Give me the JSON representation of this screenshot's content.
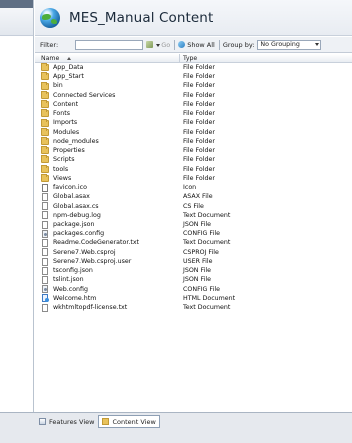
{
  "header": {
    "title": "MES_Manual Content",
    "icon": "globe-icon"
  },
  "toolbar": {
    "filter_label": "Filter:",
    "filter_value": "",
    "go_label": "Go",
    "show_all_label": "Show All",
    "group_by_label": "Group by:",
    "group_by_value": "No Grouping"
  },
  "columns": {
    "name": "Name",
    "type": "Type"
  },
  "items": [
    {
      "name": "App_Data",
      "type": "File Folder",
      "icon": "folder"
    },
    {
      "name": "App_Start",
      "type": "File Folder",
      "icon": "folder"
    },
    {
      "name": "bin",
      "type": "File Folder",
      "icon": "folder"
    },
    {
      "name": "Connected Services",
      "type": "File Folder",
      "icon": "folder"
    },
    {
      "name": "Content",
      "type": "File Folder",
      "icon": "folder"
    },
    {
      "name": "Fonts",
      "type": "File Folder",
      "icon": "folder"
    },
    {
      "name": "Imports",
      "type": "File Folder",
      "icon": "folder"
    },
    {
      "name": "Modules",
      "type": "File Folder",
      "icon": "folder"
    },
    {
      "name": "node_modules",
      "type": "File Folder",
      "icon": "folder"
    },
    {
      "name": "Properties",
      "type": "File Folder",
      "icon": "folder"
    },
    {
      "name": "Scripts",
      "type": "File Folder",
      "icon": "folder"
    },
    {
      "name": "tools",
      "type": "File Folder",
      "icon": "folder"
    },
    {
      "name": "Views",
      "type": "File Folder",
      "icon": "folder"
    },
    {
      "name": "favicon.ico",
      "type": "Icon",
      "icon": "icon"
    },
    {
      "name": "Global.asax",
      "type": "ASAX File",
      "icon": "file"
    },
    {
      "name": "Global.asax.cs",
      "type": "CS File",
      "icon": "file"
    },
    {
      "name": "npm-debug.log",
      "type": "Text Document",
      "icon": "file"
    },
    {
      "name": "package.json",
      "type": "JSON File",
      "icon": "file"
    },
    {
      "name": "packages.config",
      "type": "CONFIG File",
      "icon": "config"
    },
    {
      "name": "Readme.CodeGenerator.txt",
      "type": "Text Document",
      "icon": "file"
    },
    {
      "name": "Serene7.Web.csproj",
      "type": "CSPROJ File",
      "icon": "file"
    },
    {
      "name": "Serene7.Web.csproj.user",
      "type": "USER File",
      "icon": "file"
    },
    {
      "name": "tsconfig.json",
      "type": "JSON File",
      "icon": "file"
    },
    {
      "name": "tslint.json",
      "type": "JSON File",
      "icon": "file"
    },
    {
      "name": "Web.config",
      "type": "CONFIG File",
      "icon": "config"
    },
    {
      "name": "Welcome.htm",
      "type": "HTML Document",
      "icon": "html"
    },
    {
      "name": "wkhtmltopdf-license.txt",
      "type": "Text Document",
      "icon": "file"
    }
  ],
  "bottom_tabs": [
    {
      "label": "Features View",
      "active": false
    },
    {
      "label": "Content View",
      "active": true
    }
  ]
}
